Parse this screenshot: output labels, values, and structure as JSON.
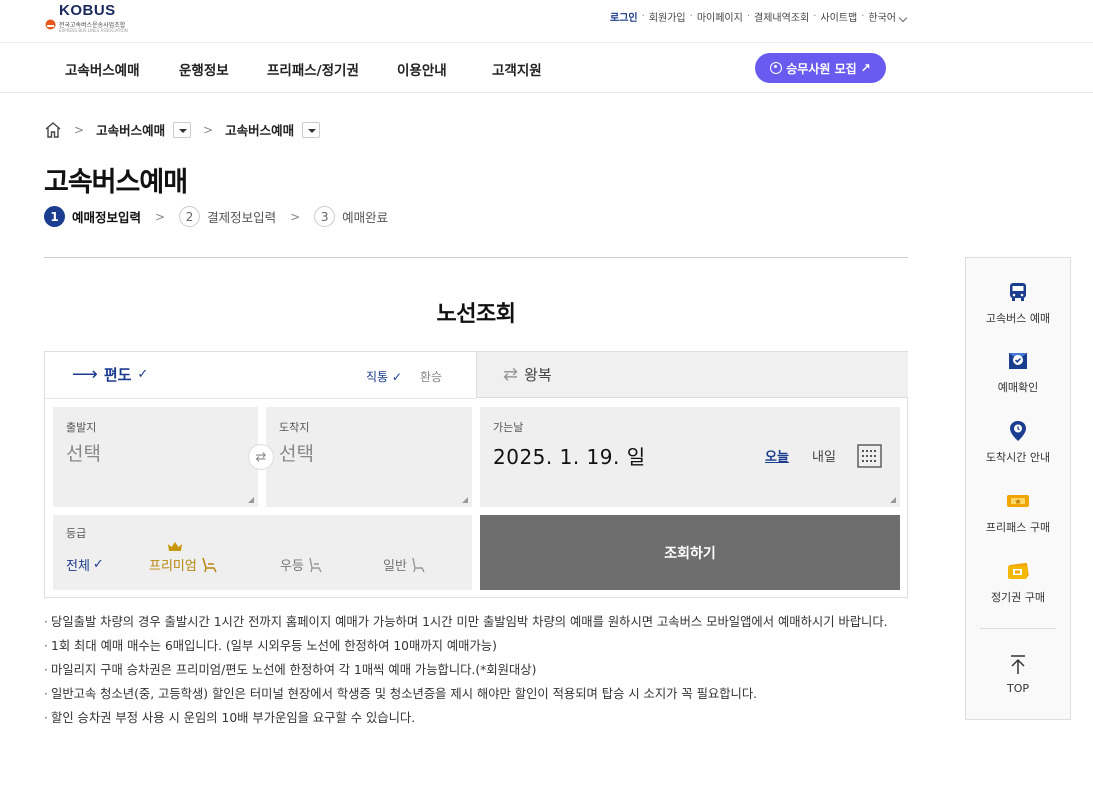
{
  "brand": {
    "logo_text": "KOBUS",
    "logo_sub": "전국고속버스운송사업조합",
    "logo_sub_en": "EXPRESS BUS LINES ASSOCIATION"
  },
  "util_menu": {
    "login": "로그인",
    "items": [
      "회원가입",
      "마이페이지",
      "결제내역조회",
      "사이트맵"
    ],
    "language": "한국어"
  },
  "nav": {
    "items": [
      "고속버스예매",
      "운행정보",
      "프리패스/정기권",
      "이용안내",
      "고객지원"
    ],
    "recruit_label": "승무사원 모집",
    "recruit_arrow": "↗"
  },
  "breadcrumb": {
    "level1": "고속버스예매",
    "level2": "고속버스예매"
  },
  "page_title": "고속버스예매",
  "steps": [
    {
      "num": "1",
      "label": "예매정보입력",
      "active": true
    },
    {
      "num": "2",
      "label": "결제정보입력",
      "active": false
    },
    {
      "num": "3",
      "label": "예매완료",
      "active": false
    }
  ],
  "search": {
    "section_title": "노선조회",
    "tab_oneway": "편도",
    "tab_oneway_check": "✓",
    "route_direct": "직통",
    "route_direct_check": "✓",
    "route_transfer": "환승",
    "tab_round": "왕복",
    "departure_caption": "출발지",
    "departure_value": "선택",
    "arrival_caption": "도착지",
    "arrival_value": "선택",
    "date_caption": "가는날",
    "date_value": "2025. 1. 19. 일",
    "today_label": "오늘",
    "tomorrow_label": "내일",
    "grade_caption": "등급",
    "grade_all": "전체",
    "grade_all_check": "✓",
    "grade_premium": "프리미엄",
    "grade_excellent": "우등",
    "grade_normal": "일반",
    "search_button": "조회하기"
  },
  "notices": [
    "당일출발 차량의 경우 출발시간 1시간 전까지 홈페이지 예매가 가능하며 1시간 미만 출발임박 차량의 예매를 원하시면 고속버스 모바일앱에서 예매하시기 바랍니다.",
    "1회 최대 예매 매수는 6매입니다. (일부 시외우등 노선에 한정하여 10매까지 예매가능)",
    "마일리지 구매 승차권은 프리미엄/편도 노선에 한정하여 각 1매씩 예매 가능합니다.(*회원대상)",
    "일반고속 청소년(중, 고등학생) 할인은 터미널 현장에서 학생증 및 청소년증을 제시 해야만 할인이 적용되며 탑승 시 소지가 꼭 필요합니다.",
    "할인 승차권 부정 사용 시 운임의 10배 부가운임을 요구할 수 있습니다."
  ],
  "quick_menu": {
    "items": [
      "고속버스 예매",
      "예매확인",
      "도착시간 안내",
      "프리패스 구매",
      "정기권 구매"
    ],
    "top_label": "TOP"
  },
  "colors": {
    "primary": "#1b3d8f",
    "accent": "#6a5bf0",
    "premium": "#b8860b",
    "search_button": "#6e6e6e",
    "field_bg": "#efefef"
  }
}
